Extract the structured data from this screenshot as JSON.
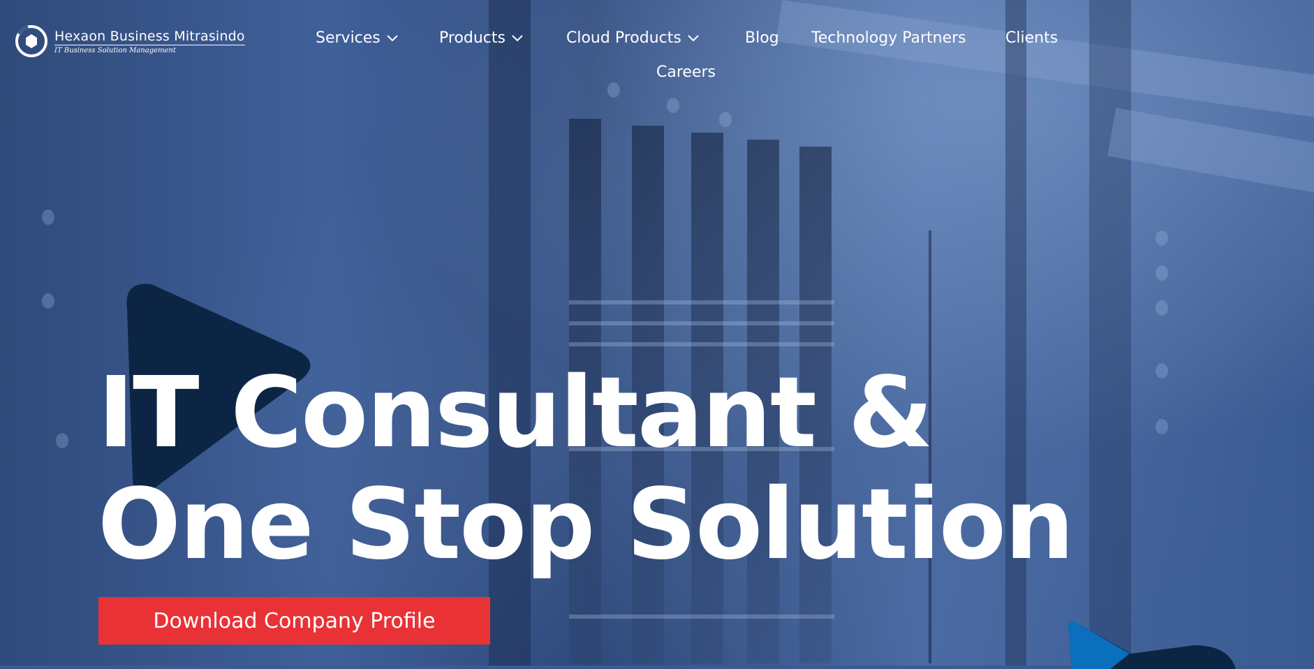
{
  "brand": {
    "name": "Hexaon Business Mitrasindo",
    "tagline": "IT Business Solution Management",
    "logo_icon": "hexagon-ring-logo-icon"
  },
  "nav": {
    "items": [
      {
        "label": "Services",
        "has_dropdown": true
      },
      {
        "label": "Products",
        "has_dropdown": true
      },
      {
        "label": "Cloud Products",
        "has_dropdown": true
      },
      {
        "label": "Blog",
        "has_dropdown": false
      },
      {
        "label": "Technology Partners",
        "has_dropdown": false
      },
      {
        "label": "Clients",
        "has_dropdown": false
      },
      {
        "label": "Careers",
        "has_dropdown": false
      }
    ],
    "dropdown_icon": "chevron-down-icon"
  },
  "hero": {
    "headline_line1": "IT Consultant &",
    "headline_line2": "One Stop Solution",
    "cta_label": "Download Company Profile"
  },
  "colors": {
    "overlay_blue": "#3c5a8e",
    "triangle_dark": "#0d2544",
    "triangle_accent": "#0a6fbd",
    "cta_red": "#e83236",
    "text": "#ffffff"
  }
}
